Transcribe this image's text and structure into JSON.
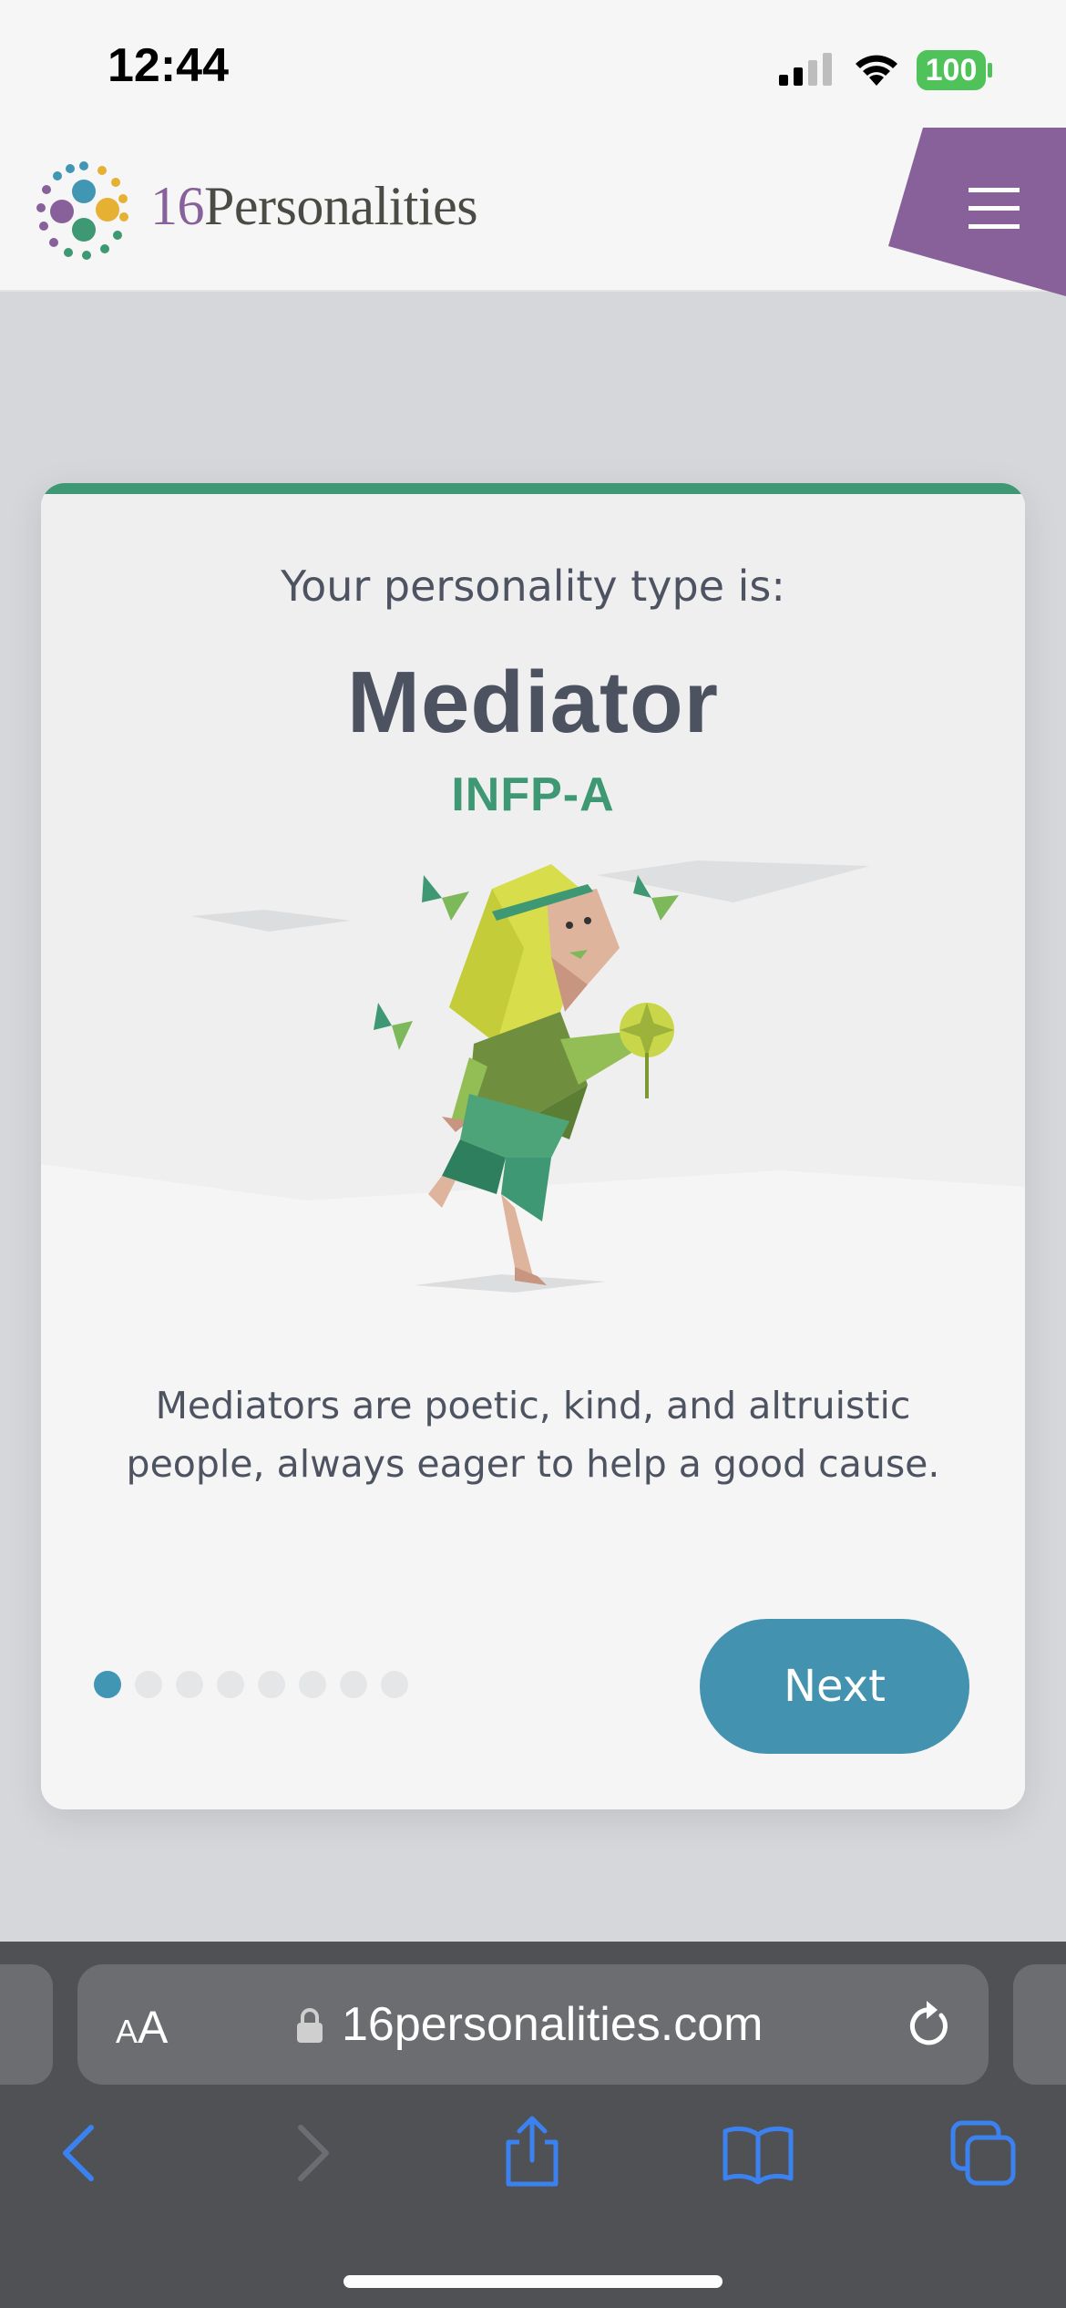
{
  "status_bar": {
    "time": "12:44",
    "battery": "100",
    "icons": [
      "signal-icon",
      "wifi-icon",
      "battery-icon"
    ]
  },
  "header": {
    "logo_number": "16",
    "logo_word": "Personalities",
    "menu_icon": "hamburger-menu-icon",
    "accent_color": "#88619a"
  },
  "card": {
    "intro": "Your personality type is:",
    "type_name": "Mediator",
    "type_code": "INFP-A",
    "description": "Mediators are poetic, kind, and altruistic people, always eager to help a good cause.",
    "pagination": {
      "total": 8,
      "current": 1
    },
    "next_label": "Next",
    "accent_color": "#3d9873",
    "button_color": "#4393b0"
  },
  "browser": {
    "text_size_label_small": "A",
    "text_size_label_large": "A",
    "url": "16personalities.com",
    "toolbar_icons": [
      "back-icon",
      "forward-icon",
      "share-icon",
      "bookmarks-icon",
      "tabs-icon"
    ]
  }
}
